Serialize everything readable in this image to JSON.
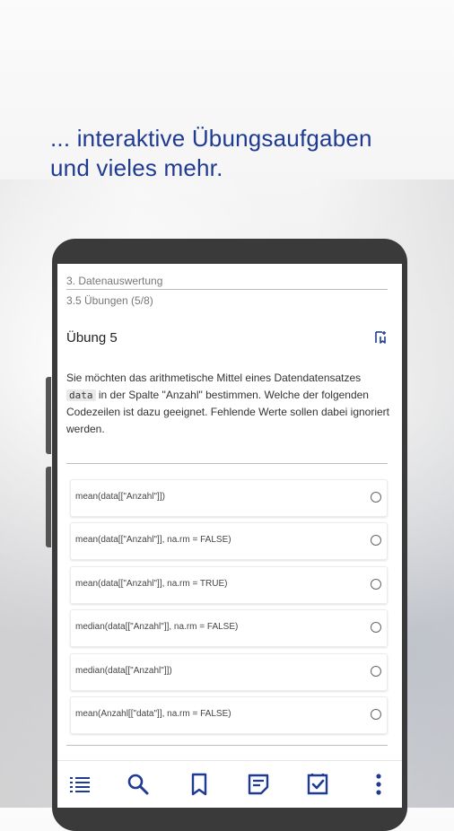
{
  "headline": {
    "line1": "... interaktive Übungsaufgaben",
    "line2": "und vieles mehr."
  },
  "breadcrumb": {
    "chapter": "3. Datenauswertung",
    "section": "3.5 Übungen (5/8)"
  },
  "exercise": {
    "title": "Übung 5",
    "question_part1": "Sie möchten das arithmetische Mittel eines Datendatensatzes",
    "question_code": "data",
    "question_part2": "in der Spalte \"Anzahl\" bestimmen. Welche der folgenden Codezeilen ist dazu geeignet. Fehlende Werte sollen dabei ignoriert werden."
  },
  "options": [
    "mean(data[[\"Anzahl\"]])",
    "mean(data[[\"Anzahl\"]], na.rm = FALSE)",
    "mean(data[[\"Anzahl\"]], na.rm = TRUE)",
    "median(data[[\"Anzahl\"]], na.rm = FALSE)",
    "median(data[[\"Anzahl\"]])",
    "mean(Anzahl[[\"data\"]], na.rm = FALSE)"
  ],
  "bottom_nav": {
    "icons": [
      "toc-icon",
      "search-icon",
      "bookmark-icon",
      "notes-icon",
      "bookmarks-list-icon",
      "more-vert-icon"
    ]
  },
  "colors": {
    "brand": "#1f3a93"
  }
}
